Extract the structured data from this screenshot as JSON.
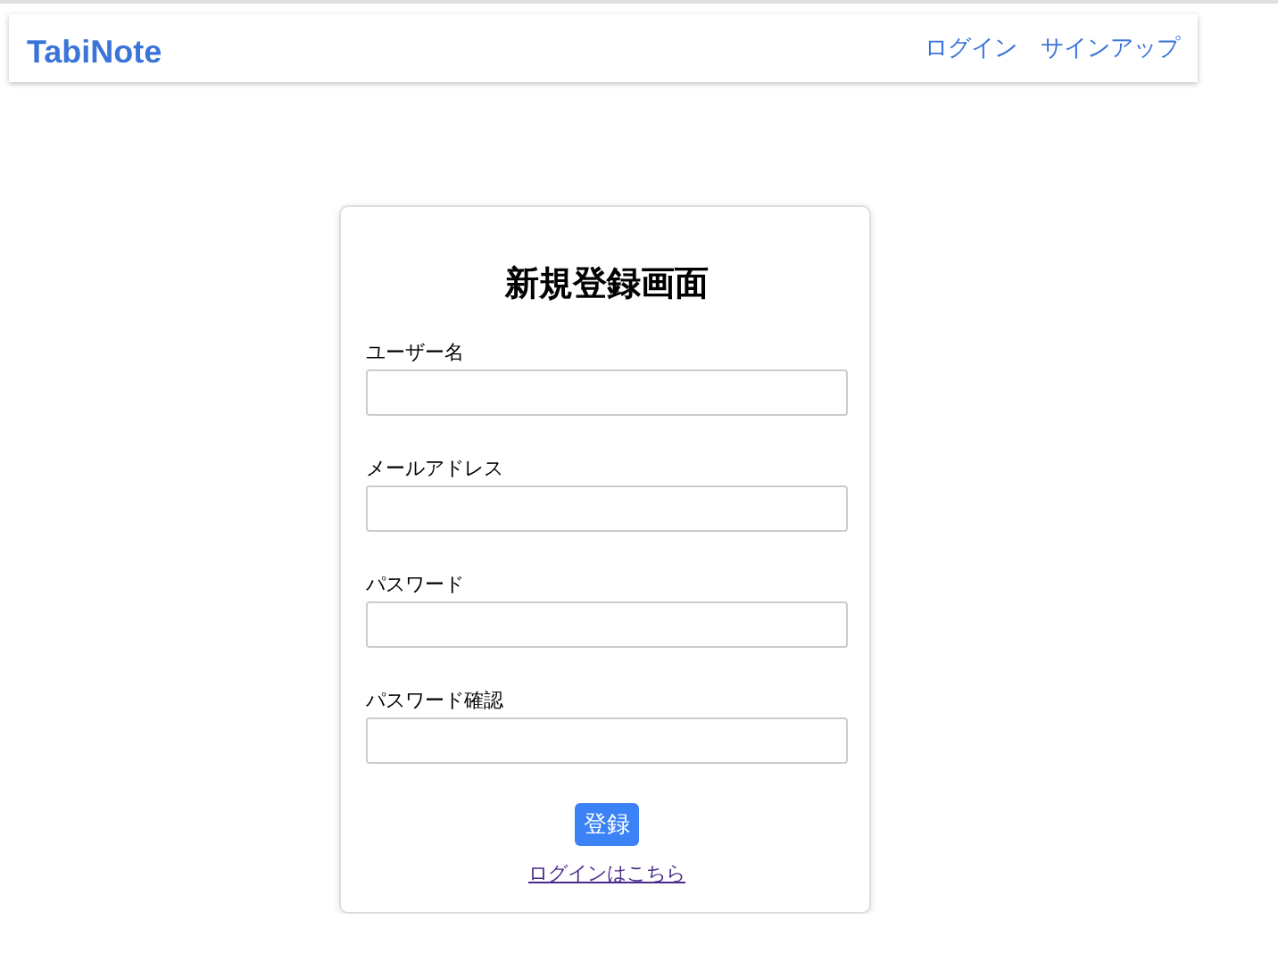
{
  "navbar": {
    "brand": "TabiNote",
    "links": [
      "ログイン",
      "サインアップ"
    ]
  },
  "form": {
    "title": "新規登録画面",
    "fields": [
      {
        "label": "ユーザー名"
      },
      {
        "label": "メールアドレス"
      },
      {
        "label": "パスワード"
      },
      {
        "label": "パスワード確認"
      }
    ],
    "submit": "登録",
    "login_link": "ログインはこちら"
  }
}
